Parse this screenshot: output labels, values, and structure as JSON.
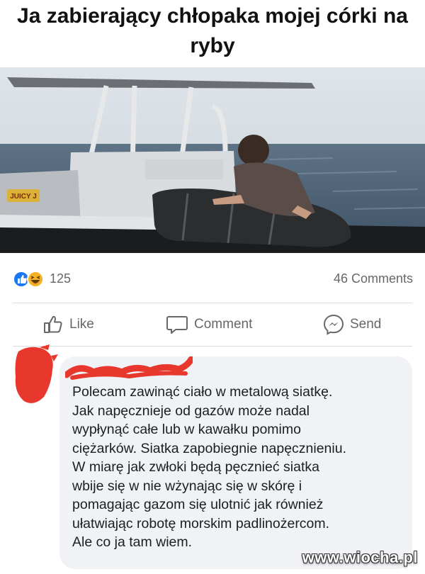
{
  "meme": {
    "title": "Ja zabierający chłopaka mojej córki na ryby"
  },
  "video": {
    "channel_logo_text": "JUICY J"
  },
  "post_stats": {
    "reaction_icons": [
      "like-icon",
      "haha-icon"
    ],
    "reaction_count": "125",
    "comments_label": "46 Comments"
  },
  "actions": {
    "like_label": "Like",
    "comment_label": "Comment",
    "send_label": "Send"
  },
  "comment": {
    "author": "redacted",
    "text": "Polecam zawinąć ciało w metalową siatkę.\nJak napęcznieje od gazów może nadal\nwypłynąć całe lub w kawałku pomimo\nciężarków. Siatka zapobiegnie napęcznieniu.\nW miarę jak zwłoki będą pęcznieć siatka\nwbije się w nie wżynając się w skórę i\npomagając gazom się ulotnić jak również\nułatwiając robotę morskim padlinożercom.\nAle co ja tam wiem."
  },
  "watermark": "www.wiocha.pl",
  "colors": {
    "like_blue": "#1877f2",
    "haha_yellow": "#f7b125",
    "redaction_red": "#e8372c",
    "bubble_gray": "#f0f2f5",
    "secondary_text": "#65676b"
  }
}
